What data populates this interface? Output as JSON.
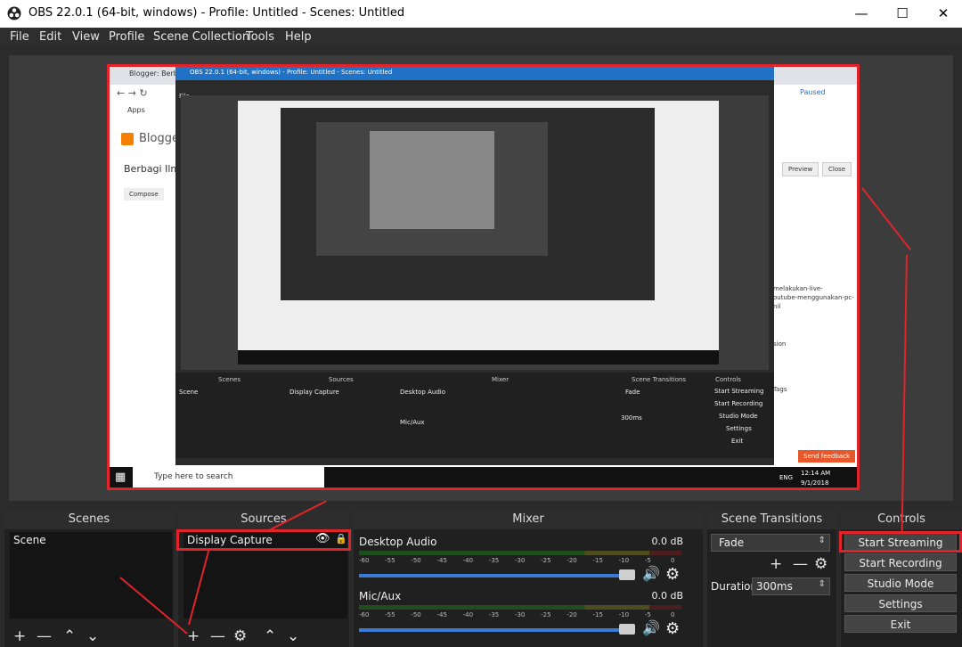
{
  "window": {
    "title": "OBS 22.0.1 (64-bit, windows) - Profile: Untitled - Scenes: Untitled",
    "minimize_icon": "minimize-icon",
    "maximize_icon": "maximize-icon",
    "close_icon": "close-icon"
  },
  "menu": [
    "File",
    "Edit",
    "View",
    "Profile",
    "Scene Collection",
    "Tools",
    "Help"
  ],
  "preview": {
    "inner_title": "OBS 22.0.1 (64-bit, windows) - Profile: Untitled - Scenes: Untitled",
    "browser_tab": "Blogger: Berbagi",
    "blog_name": "Blogger",
    "post_title": "Berbagi Ilm",
    "compose_tab": "Compose",
    "paused_label": "Paused",
    "preview_button": "Preview",
    "close_button": "Close",
    "apps_label": "Apps",
    "side_text_1": "melakukan-live-",
    "side_text_2": "outube-menggunakan-pc-",
    "side_text_3": "nil",
    "side_text_4": "sion",
    "side_text_5": "Tags",
    "send_feedback": "Send feedback",
    "taskbar_search": "Type here to search",
    "clock_time": "12:14 AM",
    "clock_date": "9/1/2018",
    "lang": "ENG"
  },
  "docks": {
    "scenes": {
      "title": "Scenes",
      "items": [
        "Scene"
      ]
    },
    "sources": {
      "title": "Sources",
      "items": [
        "Display Capture"
      ]
    },
    "mixer": {
      "title": "Mixer",
      "channels": [
        {
          "name": "Desktop Audio",
          "db": "0.0 dB"
        },
        {
          "name": "Mic/Aux",
          "db": "0.0 dB"
        }
      ],
      "ticks": [
        "-60",
        "-55",
        "-50",
        "-45",
        "-40",
        "-35",
        "-30",
        "-25",
        "-20",
        "-15",
        "-10",
        "-5",
        "0"
      ]
    },
    "transitions": {
      "title": "Scene Transitions",
      "selected": "Fade",
      "duration_label": "Duration",
      "duration_value": "300ms"
    },
    "controls": {
      "title": "Controls",
      "buttons": [
        "Start Streaming",
        "Start Recording",
        "Studio Mode",
        "Settings",
        "Exit"
      ]
    }
  },
  "colors": {
    "highlight_red": "#e0242a",
    "fader_blue": "#3a7bd5",
    "panel_bg": "#202020"
  }
}
